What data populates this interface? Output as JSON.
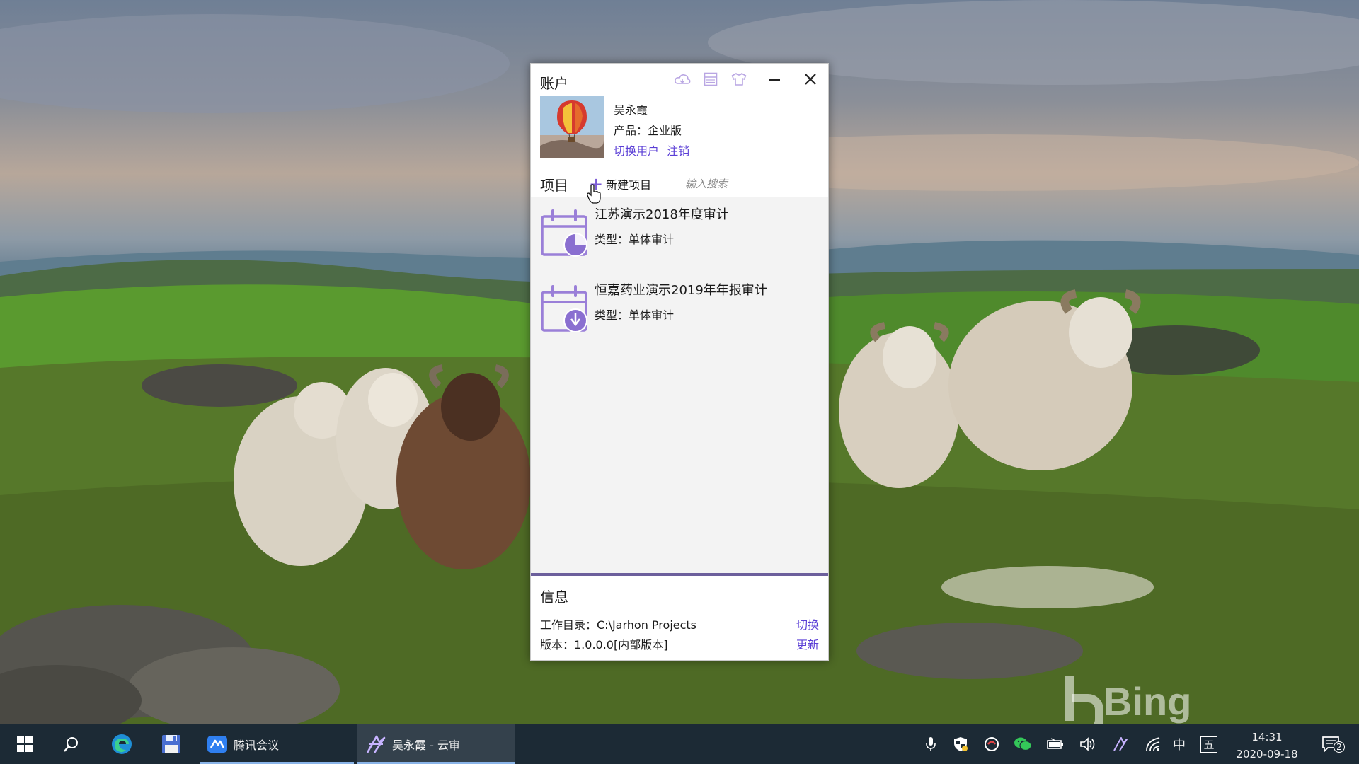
{
  "window": {
    "title": "账户",
    "tb_icons": [
      "cloud-icon",
      "layout-icon",
      "shirt-icon",
      "minimize-icon",
      "close-icon"
    ]
  },
  "account": {
    "name": "吴永霞",
    "product": "产品：企业版",
    "switch_user": "切换用户",
    "logout": "注销"
  },
  "projects": {
    "title": "项目",
    "new_label": "新建项目",
    "search_placeholder": "输入搜索",
    "items": [
      {
        "name": "江苏演示2018年度审计",
        "type": "类型：单体审计"
      },
      {
        "name": "恒嘉药业演示2019年年报审计",
        "type": "类型：单体审计"
      }
    ]
  },
  "info": {
    "title": "信息",
    "workdir": "工作目录：C:\\Jarhon Projects",
    "workdir_action": "切换",
    "version": "版本：1.0.0.0[内部版本]",
    "version_action": "更新"
  },
  "desktop": {
    "bing": "Bing"
  },
  "taskbar": {
    "meeting_app": "腾讯会议",
    "audit_app": "吴永霞 - 云审",
    "ime_lang": "中",
    "ime_mode": "五",
    "time": "14:31",
    "date": "2020-09-18",
    "notifications": "2"
  },
  "colors": {
    "accent": "#5b3fd6",
    "icon_purple": "#9a7fd8",
    "taskbar": "#1c2a35"
  }
}
